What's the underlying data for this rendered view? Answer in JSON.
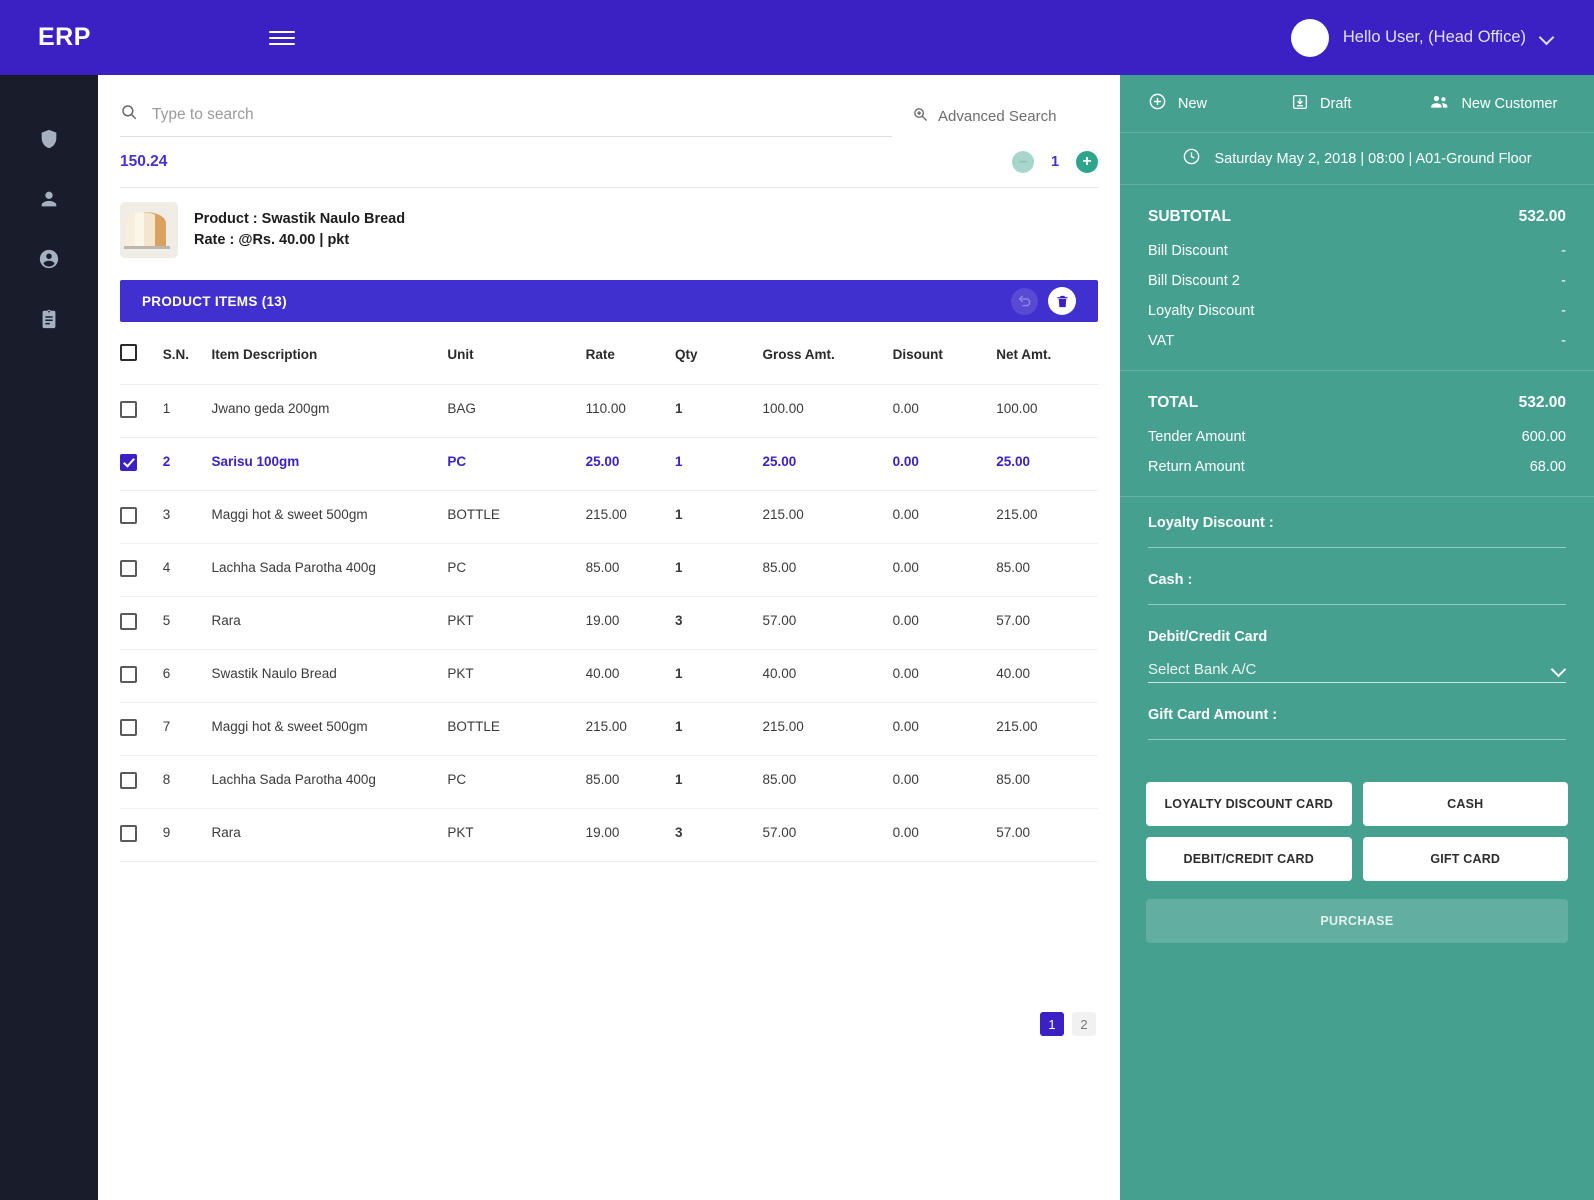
{
  "header": {
    "brand": "ERP",
    "menu_icon": "hamburger-icon",
    "user_greeting": "Hello User, (Head Office)"
  },
  "sidebar": {
    "items": [
      {
        "icon": "shield-icon",
        "name": "security"
      },
      {
        "icon": "person-icon",
        "name": "person"
      },
      {
        "icon": "account-circle-icon",
        "name": "account"
      },
      {
        "icon": "clipboard-icon",
        "name": "reports"
      }
    ]
  },
  "search": {
    "placeholder": "Type to search",
    "value": "",
    "advanced_label": "Advanced Search"
  },
  "quantity_row": {
    "price": "150.24",
    "qty": "1",
    "minus_label": "–",
    "plus_label": "+"
  },
  "product_preview": {
    "product_line": "Product : Swastik Naulo Bread",
    "rate_line": "Rate : @Rs. 40.00 | pkt"
  },
  "items_panel": {
    "title": "PRODUCT ITEMS (13)",
    "undo_icon": "undo-icon",
    "delete_icon": "trash-icon",
    "columns": [
      "S.N.",
      "Item Description",
      "Unit",
      "Rate",
      "Qty",
      "Gross Amt.",
      "Disount",
      "Net Amt."
    ],
    "rows": [
      {
        "checked": false,
        "sn": "1",
        "desc": "Jwano geda 200gm",
        "unit": "BAG",
        "rate": "110.00",
        "qty": "1",
        "gross": "100.00",
        "discount": "0.00",
        "net": "100.00"
      },
      {
        "checked": true,
        "sn": "2",
        "desc": "Sarisu 100gm",
        "unit": "PC",
        "rate": "25.00",
        "qty": "1",
        "gross": "25.00",
        "discount": "0.00",
        "net": "25.00"
      },
      {
        "checked": false,
        "sn": "3",
        "desc": "Maggi hot & sweet 500gm",
        "unit": "BOTTLE",
        "rate": "215.00",
        "qty": "1",
        "gross": "215.00",
        "discount": "0.00",
        "net": "215.00"
      },
      {
        "checked": false,
        "sn": "4",
        "desc": "Lachha Sada Parotha 400g",
        "unit": "PC",
        "rate": "85.00",
        "qty": "1",
        "gross": "85.00",
        "discount": "0.00",
        "net": "85.00"
      },
      {
        "checked": false,
        "sn": "5",
        "desc": "Rara",
        "unit": "PKT",
        "rate": "19.00",
        "qty": "3",
        "gross": "57.00",
        "discount": "0.00",
        "net": "57.00"
      },
      {
        "checked": false,
        "sn": "6",
        "desc": "Swastik Naulo Bread",
        "unit": "PKT",
        "rate": "40.00",
        "qty": "1",
        "gross": "40.00",
        "discount": "0.00",
        "net": "40.00"
      },
      {
        "checked": false,
        "sn": "7",
        "desc": "Maggi hot & sweet 500gm",
        "unit": "BOTTLE",
        "rate": "215.00",
        "qty": "1",
        "gross": "215.00",
        "discount": "0.00",
        "net": "215.00"
      },
      {
        "checked": false,
        "sn": "8",
        "desc": "Lachha Sada Parotha 400g",
        "unit": "PC",
        "rate": "85.00",
        "qty": "1",
        "gross": "85.00",
        "discount": "0.00",
        "net": "85.00"
      },
      {
        "checked": false,
        "sn": "9",
        "desc": "Rara",
        "unit": "PKT",
        "rate": "19.00",
        "qty": "3",
        "gross": "57.00",
        "discount": "0.00",
        "net": "57.00"
      }
    ],
    "pagination": {
      "pages": [
        "1",
        "2"
      ],
      "active": "1"
    }
  },
  "right_panel": {
    "actions": [
      {
        "label": "New",
        "icon": "plus-circle-icon"
      },
      {
        "label": "Draft",
        "icon": "save-draft-icon"
      },
      {
        "label": "New Customer",
        "icon": "people-icon"
      }
    ],
    "date_line": "Saturday May 2, 2018 | 08:00 | A01-Ground Floor",
    "clock_icon": "clock-icon",
    "summary": [
      {
        "label": "SUBTOTAL",
        "value": "532.00",
        "emphasis": true
      },
      {
        "label": "Bill Discount",
        "value": "-",
        "emphasis": false
      },
      {
        "label": "Bill Discount 2",
        "value": "-",
        "emphasis": false
      },
      {
        "label": "Loyalty Discount",
        "value": "-",
        "emphasis": false
      },
      {
        "label": "VAT",
        "value": "-",
        "emphasis": false
      }
    ],
    "totals": [
      {
        "label": "TOTAL",
        "value": "532.00",
        "emphasis": true
      },
      {
        "label": "Tender Amount",
        "value": "600.00",
        "emphasis": false
      },
      {
        "label": "Return Amount",
        "value": "68.00",
        "emphasis": false
      }
    ],
    "fields": [
      {
        "label": "Loyalty Discount :",
        "value": "",
        "type": "text"
      },
      {
        "label": "Cash :",
        "value": "",
        "type": "text"
      },
      {
        "label": "Debit/Credit Card",
        "value": "Select Bank A/C",
        "type": "select"
      },
      {
        "label": "Gift Card Amount :",
        "value": "",
        "type": "text"
      }
    ],
    "pay_buttons": [
      "LOYALTY DISCOUNT CARD",
      "CASH",
      "DEBIT/CREDIT CARD",
      "GIFT CARD"
    ],
    "purchase_label": "PURCHASE"
  },
  "colors": {
    "brand_purple": "#3b21c4",
    "items_bar_purple": "#4030cf",
    "teal": "#45a090",
    "sidebar_dark": "#191c2b",
    "accent_blue": "#4432d0"
  }
}
